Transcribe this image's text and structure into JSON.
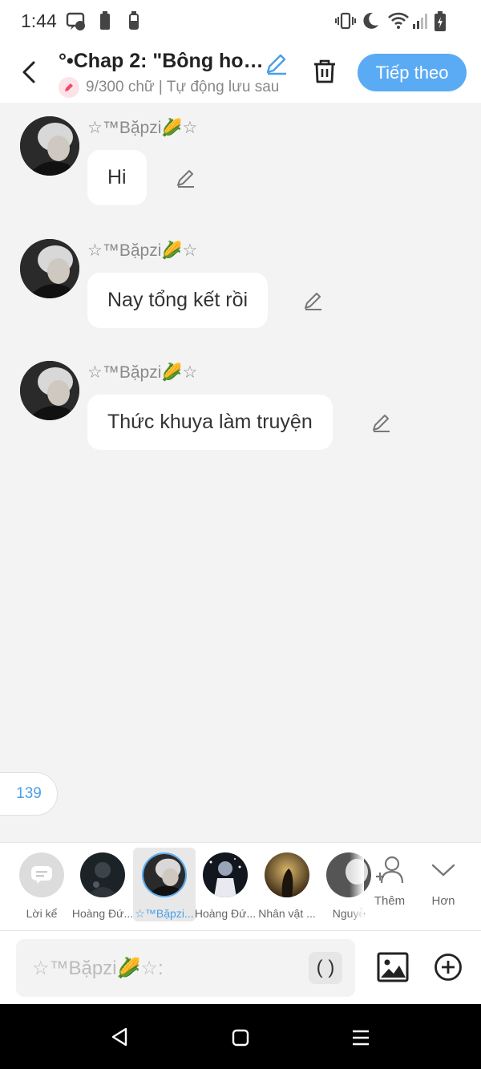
{
  "status_bar": {
    "time": "1:44"
  },
  "header": {
    "title": "°•Chap 2: \"Bông ho…",
    "subtitle": "9/300 chữ | Tự động lưu sau",
    "next_button": "Tiếp theo"
  },
  "messages": [
    {
      "sender": "☆™Bặpzi🌽☆",
      "text": "Hi"
    },
    {
      "sender": "☆™Bặpzi🌽☆",
      "text": "Nay tổng kết rồi"
    },
    {
      "sender": "☆™Bặpzi🌽☆",
      "text": "Thức khuya làm truyện"
    }
  ],
  "counter": "139",
  "characters": [
    {
      "label": "Lời kể"
    },
    {
      "label": "Hoàng Đứ..."
    },
    {
      "label": "☆™Bặpzi..."
    },
    {
      "label": "Hoàng Đứ..."
    },
    {
      "label": "Nhân vật ..."
    },
    {
      "label": "Nguyễ"
    }
  ],
  "tools": {
    "add_label": "Thêm",
    "more_label": "Hơn"
  },
  "input": {
    "placeholder": "☆™Bặpzi🌽☆:",
    "paren_label": "( )"
  },
  "colors": {
    "accent": "#5aabf4",
    "background": "#f3f3f3"
  }
}
